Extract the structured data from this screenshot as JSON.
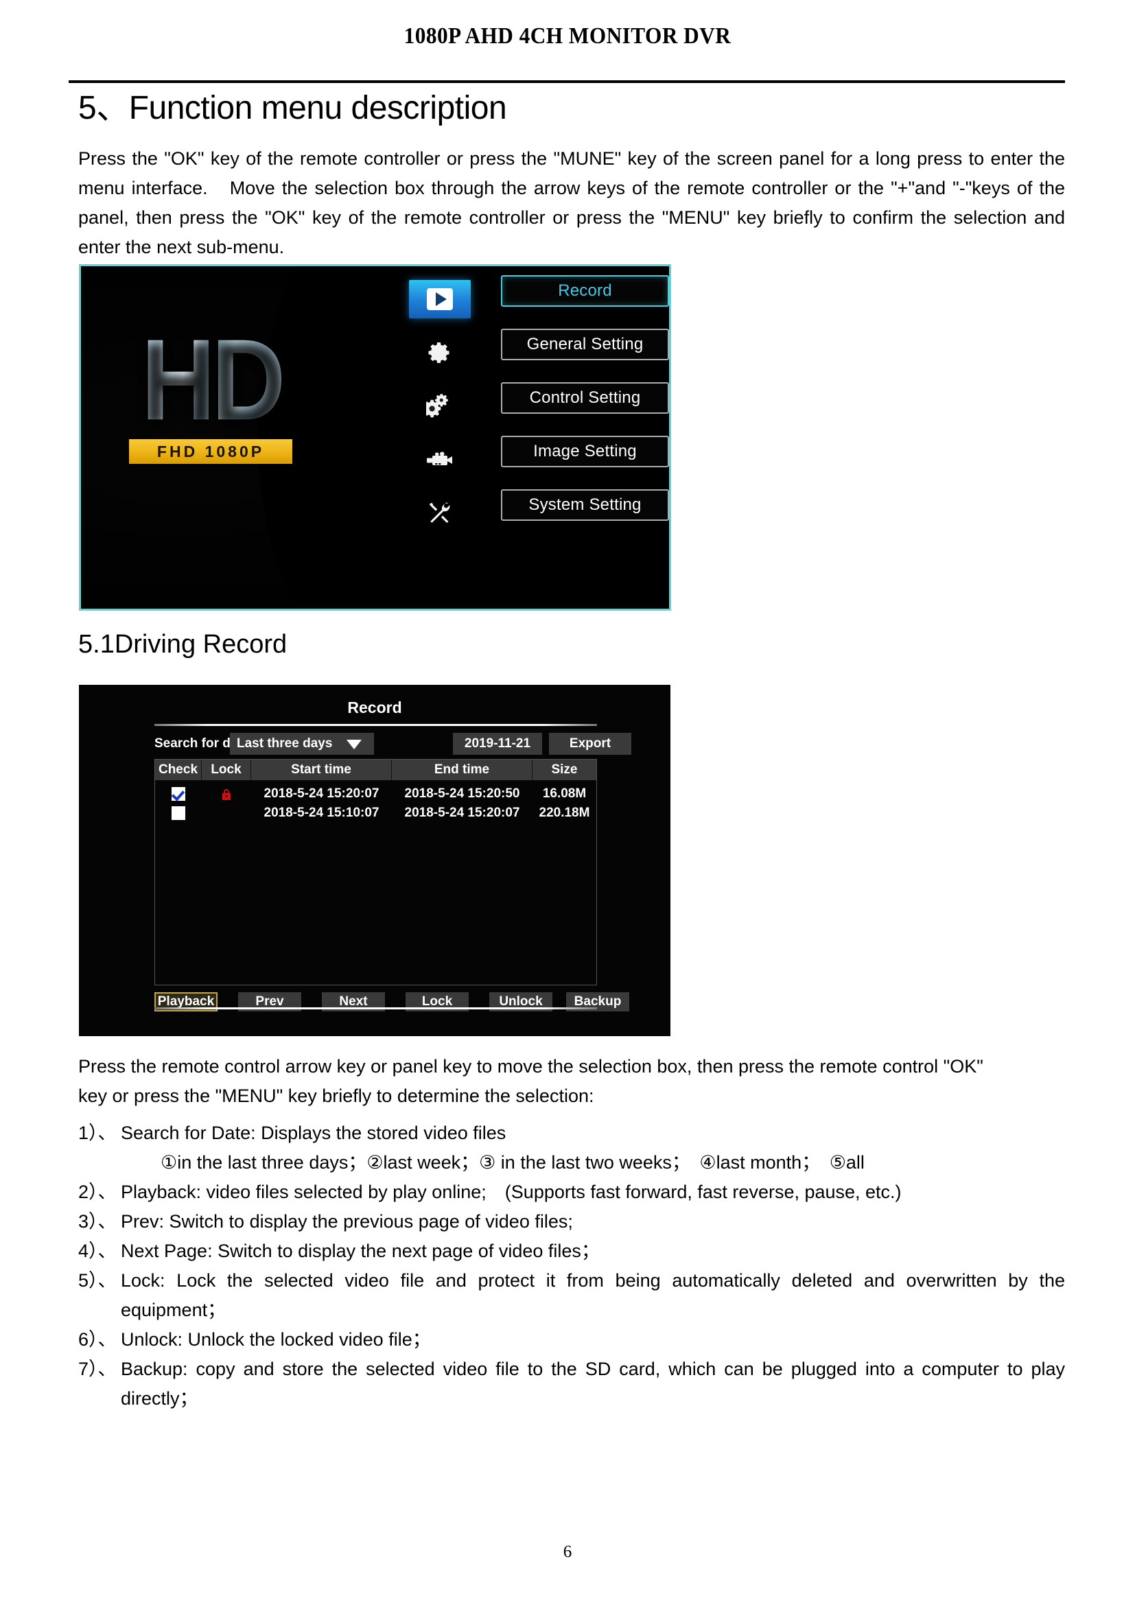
{
  "document": {
    "running_head": "1080P AHD 4CH MONITOR DVR",
    "page_number": "6"
  },
  "section": {
    "heading": "5、Function menu description",
    "intro": "Press the \"OK\" key of the remote controller or press the \"MUNE\" key of the screen panel for a long press to enter the menu interface.　Move the selection box through the arrow keys of the remote controller or the \"+\"and \"-\"keys of the panel, then press the \"OK\" key of the remote controller or press the \"MENU\" key briefly to confirm the selection and enter the next sub-menu."
  },
  "subsection": {
    "heading": "5.1Driving Record",
    "intro": "Press the remote control arrow key or panel key to move the selection box, then press the remote control \"OK\" key or press the \"MENU\" key briefly to determine the selection:",
    "items": [
      {
        "marker": "1）、",
        "text": "Search for Date: Displays the stored video files"
      },
      {
        "marker": "",
        "text": "①in the last three days；②last week；③ in the last two weeks；　④last month；　⑤all"
      },
      {
        "marker": "2）、",
        "text": "Playback: video files selected by play online;　(Supports fast forward, fast reverse, pause, etc.)"
      },
      {
        "marker": "3）、",
        "text": "Prev: Switch to display the previous page of video files;"
      },
      {
        "marker": "4）、",
        "text": "Next Page: Switch to display the next page of video files；"
      },
      {
        "marker": "5）、",
        "text": "Lock: Lock the selected video file and protect it from being automatically deleted and overwritten by the equipment；"
      },
      {
        "marker": "6）、",
        "text": "Unlock: Unlock the locked video file；"
      },
      {
        "marker": "7）、",
        "text": "Backup: copy and store the selected video file to the SD card, which can be plugged into a computer to play directly；"
      }
    ]
  },
  "menu_screenshot": {
    "logo_text": "HD",
    "logo_badge": "FHD 1080P",
    "border_color": "#55d8db",
    "selected_color": "#42c9e8",
    "rail_icons": [
      {
        "name": "play-icon",
        "active": true
      },
      {
        "name": "gear-icon",
        "active": false
      },
      {
        "name": "double-gear-icon",
        "active": false
      },
      {
        "name": "camcorder-icon",
        "active": false
      },
      {
        "name": "tools-icon",
        "active": false
      }
    ],
    "buttons": [
      {
        "label": "Record",
        "selected": true
      },
      {
        "label": "General Setting",
        "selected": false
      },
      {
        "label": "Control Setting",
        "selected": false
      },
      {
        "label": "Image Setting",
        "selected": false
      },
      {
        "label": "System Setting",
        "selected": false
      }
    ]
  },
  "record_screenshot": {
    "title": "Record",
    "search_label": "Search for date",
    "dropdown_value": "Last three days",
    "date_value": "2019-11-21",
    "export_label": "Export",
    "columns": [
      "Check",
      "Lock",
      "Start time",
      "End time",
      "Size"
    ],
    "rows": [
      {
        "checked": true,
        "locked": true,
        "start_time": "2018-5-24  15:20:07",
        "end_time": "2018-5-24  15:20:50",
        "size": "16.08M"
      },
      {
        "checked": false,
        "locked": false,
        "start_time": "2018-5-24  15:10:07",
        "end_time": "2018-5-24  15:20:07",
        "size": "220.18M"
      }
    ],
    "buttons": [
      {
        "label": "Playback",
        "selected": true
      },
      {
        "label": "Prev",
        "selected": false
      },
      {
        "label": "Next",
        "selected": false
      },
      {
        "label": "Lock",
        "selected": false
      },
      {
        "label": "Unlock",
        "selected": false
      },
      {
        "label": "Backup",
        "selected": false
      }
    ],
    "lock_icon_color": "#cc1111",
    "check_color": "#1437c4",
    "selected_border_color": "#c9a53a"
  }
}
